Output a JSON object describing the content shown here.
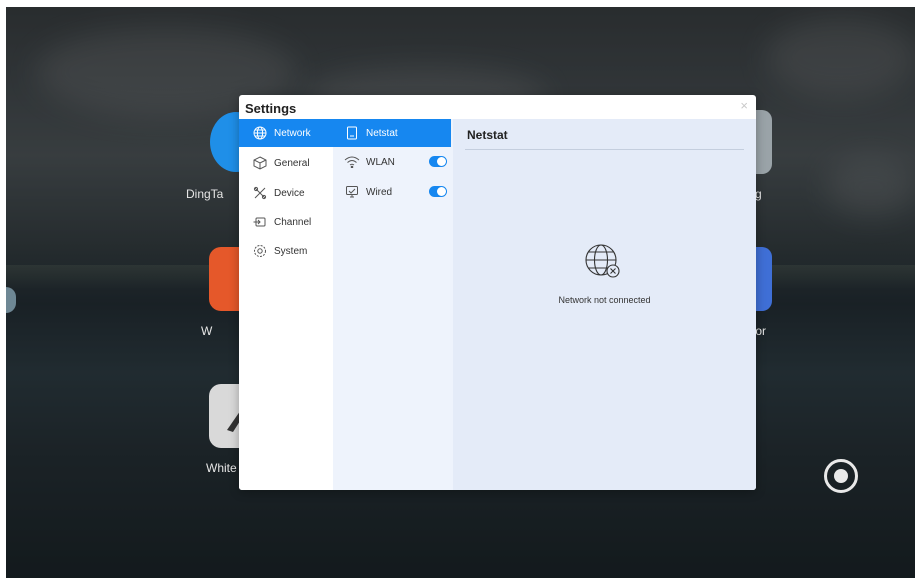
{
  "desktop": {
    "apps": [
      {
        "label": "DingTa",
        "color": "#1f8fe8"
      },
      {
        "label": "W",
        "color": "#e5582a"
      },
      {
        "label": "White",
        "color": "#d9d9d9"
      },
      {
        "label": "g",
        "color": "#9aa3a8"
      },
      {
        "label": "tor",
        "color": "#3f6fd6"
      }
    ]
  },
  "dialog": {
    "title": "Settings",
    "close_label": "×",
    "nav": [
      {
        "label": "Network",
        "icon": "globe-icon"
      },
      {
        "label": "General",
        "icon": "cube-icon"
      },
      {
        "label": "Device",
        "icon": "tools-icon"
      },
      {
        "label": "Channel",
        "icon": "channel-icon"
      },
      {
        "label": "System",
        "icon": "gear-icon"
      }
    ],
    "subnav": [
      {
        "label": "Netstat",
        "icon": "netstat-icon"
      },
      {
        "label": "WLAN",
        "icon": "wifi-icon",
        "toggle_on": true
      },
      {
        "label": "Wired",
        "icon": "wired-icon",
        "toggle_on": true
      }
    ],
    "panel": {
      "title": "Netstat",
      "message": "Network not connected",
      "icon": "globe-disconnected-icon"
    }
  },
  "colors": {
    "accent": "#1687f0",
    "sub_bg": "#eef3fc",
    "panel_bg": "#e4ebf8"
  }
}
